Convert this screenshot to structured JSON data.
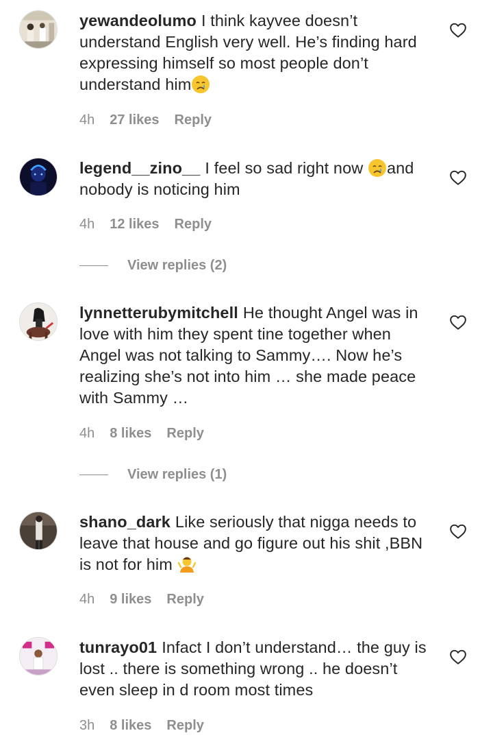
{
  "comments": [
    {
      "username": "yewandeolumo",
      "text": "I think kayvee doesn’t understand English very well. He’s finding hard expressing himself so most people don’t understand him",
      "emoji": "crying-face",
      "time": "4h",
      "likes": "27 likes",
      "reply": "Reply"
    },
    {
      "username": "legend__zino__",
      "text_before": "I feel so sad right now ",
      "emoji": "crying-face",
      "text_after": "and nobody is noticing him",
      "time": "4h",
      "likes": "12 likes",
      "reply": "Reply",
      "view_replies": "View replies (2)"
    },
    {
      "username": "lynnetterubymitchell",
      "text": "He thought Angel was in love with him they spent tine together when Angel was not talking to Sammy…. Now he’s realizing she’s not into him … she made peace with Sammy …",
      "time": "4h",
      "likes": "8 likes",
      "reply": "Reply",
      "view_replies": "View replies (1)"
    },
    {
      "username": "shano_dark",
      "text": "Like seriously that nigga needs to leave that house and go figure out his shit ,BBN is not for him ",
      "emoji": "person-shrugging",
      "time": "4h",
      "likes": "9 likes",
      "reply": "Reply"
    },
    {
      "username": "tunrayo01",
      "text": "Infact I don’t understand… the guy is lost .. there is something wrong .. he doesn’t even sleep in d room most times",
      "time": "3h",
      "likes": "8 likes",
      "reply": "Reply"
    }
  ],
  "colors": {
    "text": "#262626",
    "secondary": "#8e8e8e",
    "emoji_yellow": "#f7c62f"
  }
}
